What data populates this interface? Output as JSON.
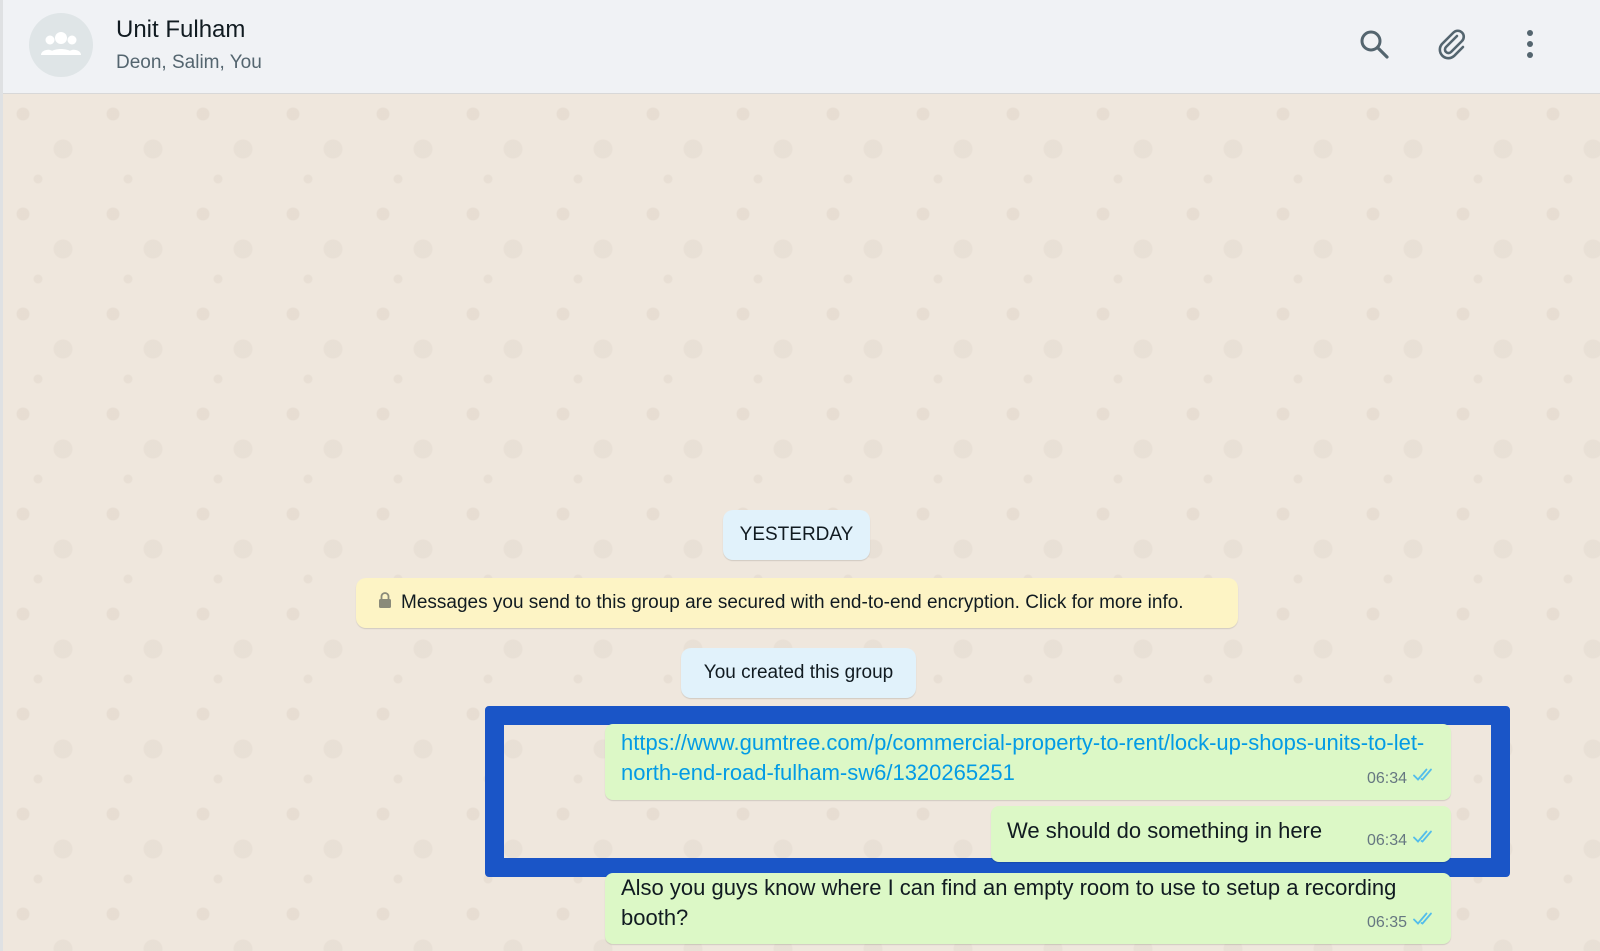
{
  "header": {
    "title": "Unit Fulham",
    "subtitle": "Deon, Salim, You",
    "avatar_icon": "group-icon",
    "actions": [
      "search-icon",
      "attach-icon",
      "menu-icon"
    ]
  },
  "chat": {
    "date_divider": "YESTERDAY",
    "encryption_notice": "Messages you send to this group are secured with end-to-end encryption. Click for more info.",
    "system_message": "You created this group",
    "messages": [
      {
        "text": "https://www.gumtree.com/p/commercial-property-to-rent/lock-up-shops-units-to-let-north-end-road-fulham-sw6/1320265251",
        "time": "06:34",
        "is_link": true
      },
      {
        "text": "We should do something in here",
        "time": "06:34",
        "is_link": false
      },
      {
        "text": "Also you guys know where I can find an empty room to use to setup a recording booth?",
        "time": "06:35",
        "is_link": false
      }
    ]
  },
  "colors": {
    "outgoing_bubble": "#dcf8c6",
    "link": "#039be5",
    "highlight_border": "#1a55c7",
    "read_ticks": "#53bdeb",
    "chat_background": "#efe7dd"
  }
}
